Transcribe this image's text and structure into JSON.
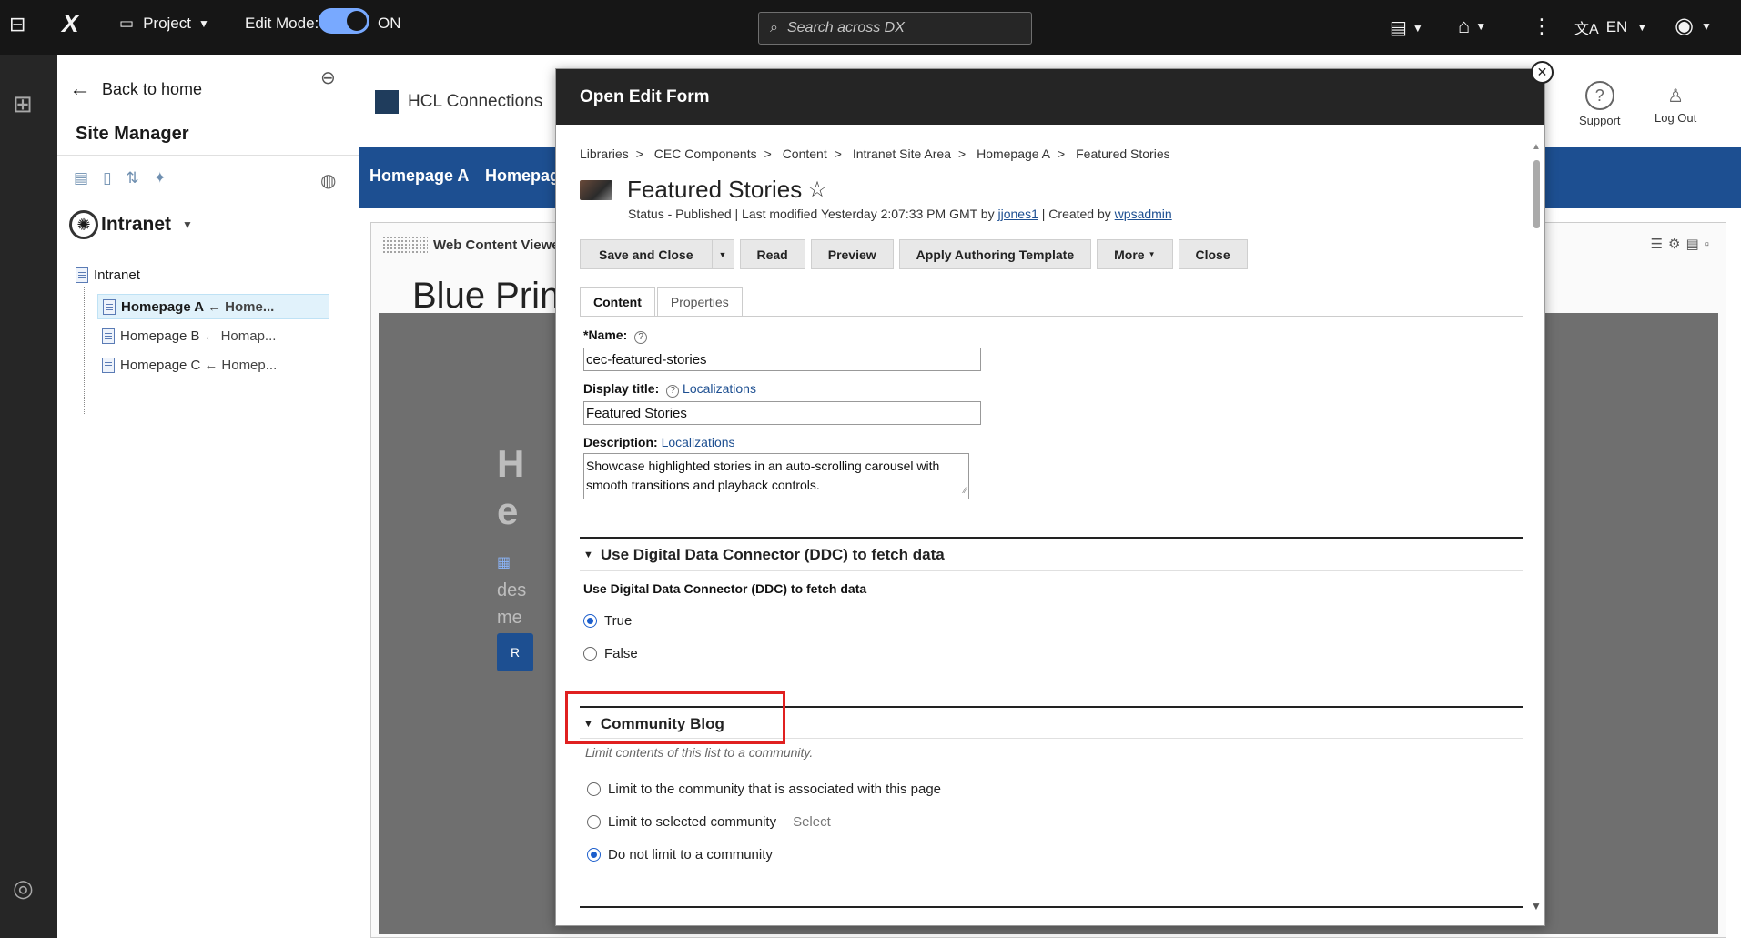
{
  "topbar": {
    "project_label": "Project",
    "edit_mode_label": "Edit Mode:",
    "edit_mode_state": "ON",
    "search_placeholder": "Search across DX",
    "language": "EN"
  },
  "panel": {
    "back_label": "Back to home",
    "title": "Site Manager",
    "site_name": "Intranet",
    "tree_root": "Intranet",
    "tree_items": [
      {
        "name": "Homepage A",
        "sub": "Home..."
      },
      {
        "name": "Homepage B",
        "sub": "Homap..."
      },
      {
        "name": "Homepage C",
        "sub": "Homep..."
      }
    ]
  },
  "background": {
    "brand": "HCL Connections",
    "nav": [
      "Homepage A",
      "Homepag"
    ],
    "support": "Support",
    "logout": "Log Out",
    "portlet_title": "Web Content Viewer",
    "heading": "Blue Prin",
    "grey_line1": "H",
    "grey_line2": "e",
    "grey_text1": "des",
    "grey_text2": "me",
    "grey_btn": "R"
  },
  "modal": {
    "title": "Open Edit Form",
    "breadcrumbs": [
      "Libraries",
      "CEC Components",
      "Content",
      "Intranet Site Area",
      "Homepage A",
      "Featured Stories"
    ],
    "crumb_sep": ">",
    "item_title": "Featured Stories",
    "status_prefix": "Status - Published | Last modified Yesterday 2:07:33 PM GMT by ",
    "modified_by": "jjones1",
    "created_prefix": " | Created by ",
    "created_by": "wpsadmin",
    "buttons": {
      "save_close": "Save and Close",
      "read": "Read",
      "preview": "Preview",
      "apply_template": "Apply Authoring Template",
      "more": "More",
      "close": "Close"
    },
    "tabs": {
      "content": "Content",
      "properties": "Properties"
    },
    "fields": {
      "name_label": "*Name:",
      "name_value": "cec-featured-stories",
      "display_label": "Display title:",
      "display_value": "Featured Stories",
      "desc_label": "Description:",
      "desc_value": "Showcase highlighted stories in an auto-scrolling carousel with smooth transitions and playback controls.",
      "localizations": "Localizations"
    },
    "ddc": {
      "section_title": "Use Digital Data Connector (DDC) to fetch data",
      "field_label": "Use Digital Data Connector (DDC) to fetch data",
      "opt_true": "True",
      "opt_false": "False"
    },
    "blog": {
      "section_title": "Community Blog",
      "hint": "Limit contents of this list to a community.",
      "opt1": "Limit to the community that is associated with this page",
      "opt2": "Limit to selected community",
      "select_link": "Select",
      "opt3": "Do not limit to a community"
    }
  },
  "colors": {
    "accent": "#1d4f91",
    "toggle": "#78a9ff",
    "highlight": "#e02020"
  }
}
